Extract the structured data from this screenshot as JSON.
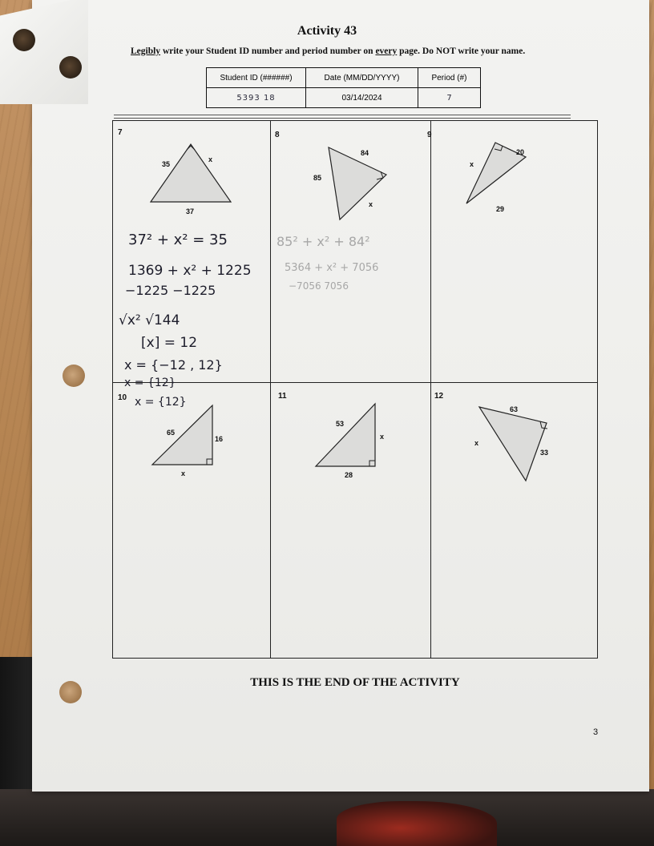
{
  "title": "Activity 43",
  "instructions": {
    "part1": "Legibly",
    "part2": " write your Student ID number and period number on ",
    "part3": "every",
    "part4": " page. Do NOT write your name."
  },
  "header_table": {
    "col1_header": "Student ID (######)",
    "col2_header": "Date (MM/DD/YYYY)",
    "col3_header": "Period (#)",
    "student_id": "5393 18",
    "date": "03/14/2024",
    "period": "7"
  },
  "problems": [
    {
      "number": "7",
      "labels": [
        "35",
        "x",
        "37"
      ]
    },
    {
      "number": "8",
      "labels": [
        "84",
        "85",
        "x"
      ]
    },
    {
      "number": "9",
      "labels": [
        "x",
        "20",
        "29"
      ]
    },
    {
      "number": "10",
      "labels": [
        "65",
        "16",
        "x"
      ]
    },
    {
      "number": "11",
      "labels": [
        "53",
        "x",
        "28"
      ]
    },
    {
      "number": "12",
      "labels": [
        "63",
        "x",
        "33"
      ]
    }
  ],
  "work7": {
    "l1": "37² + x² = 35",
    "l2": "1369 + x² + 1225",
    "l3": "−1225    −1225",
    "l4": "√x²   √144",
    "l5": "[x] = 12",
    "l6": "x = {−12 , 12}",
    "l7": "x = {12}",
    "l8": "x = {12}"
  },
  "work8": {
    "l1": "85² + x² + 84²",
    "l2": "5364 + x² + 7056",
    "l3": "−7056    7056"
  },
  "end_text": "THIS IS THE END OF THE ACTIVITY",
  "page_number": "3"
}
